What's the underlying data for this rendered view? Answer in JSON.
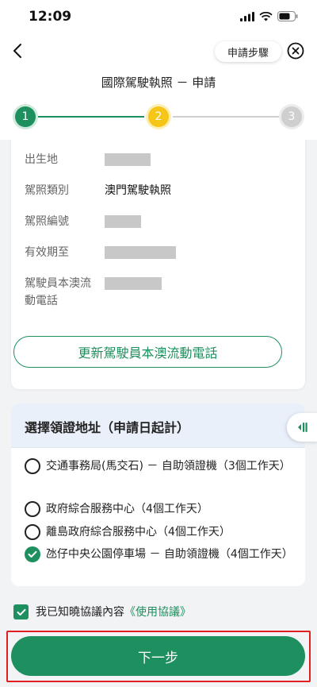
{
  "status_bar": {
    "time": "12:09"
  },
  "header": {
    "steps_label": "申請步驟",
    "title": "國際駕駛執照 － 申請"
  },
  "stepper": {
    "steps": [
      {
        "number": "1",
        "state": "done"
      },
      {
        "number": "2",
        "state": "current"
      },
      {
        "number": "3",
        "state": "pending"
      }
    ]
  },
  "info": {
    "rows": [
      {
        "label": "出生地",
        "value": ""
      },
      {
        "label": "駕照類別",
        "value": "澳門駕駛執照"
      },
      {
        "label": "駕照編號",
        "value": ""
      },
      {
        "label": "有效期至",
        "value": ""
      },
      {
        "label_line1": "駕駛員本澳流",
        "label_line2": "動電話",
        "value": ""
      }
    ],
    "update_phone_button": "更新駕駛員本澳流動電話"
  },
  "address": {
    "heading": "選擇領證地址（申請日起計）",
    "options": [
      {
        "text": "交通事務局(馬交石) － 自助領證機（3個工作天）",
        "selected": false
      },
      {
        "text": "政府綜合服務中心（4個工作天）",
        "selected": false
      },
      {
        "text": "離島政府綜合服務中心（4個工作天）",
        "selected": false
      },
      {
        "text": "氹仔中央公園停車場 － 自助領證機（4個工作天）",
        "selected": true
      }
    ]
  },
  "agreement": {
    "checked": true,
    "text": "我已知曉協議內容",
    "link": "《使用協議》"
  },
  "footer": {
    "next_button": "下一步"
  },
  "colors": {
    "primary": "#1e8f5e",
    "current_step": "#f5c518",
    "pending_step": "#cfcfcf",
    "highlight": "#e02020"
  }
}
